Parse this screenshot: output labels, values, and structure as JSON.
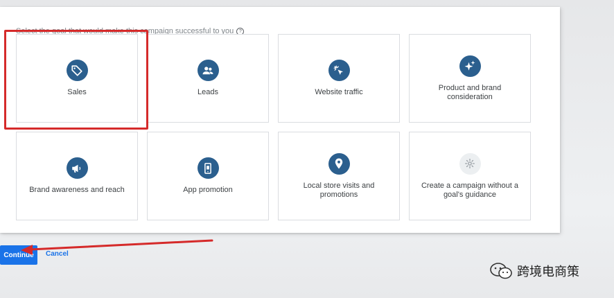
{
  "prompt": {
    "text": "Select the goal that would make this campaign successful to you",
    "help_glyph": "?"
  },
  "goals": [
    {
      "label": "Sales",
      "icon": "tag-icon",
      "selected": true
    },
    {
      "label": "Leads",
      "icon": "people-icon"
    },
    {
      "label": "Website traffic",
      "icon": "cursor-click-icon"
    },
    {
      "label": "Product and brand consideration",
      "icon": "sparkle-icon"
    },
    {
      "label": "Brand awareness and reach",
      "icon": "megaphone-icon"
    },
    {
      "label": "App promotion",
      "icon": "phone-icon"
    },
    {
      "label": "Local store visits and promotions",
      "icon": "location-pin-icon"
    },
    {
      "label": "Create a campaign without a goal's guidance",
      "icon": "gear-icon"
    }
  ],
  "actions": {
    "continue_label": "Continue",
    "cancel_label": "Cancel"
  },
  "watermark": {
    "text": "跨境电商策"
  },
  "colors": {
    "icon_bg": "#2b5f8e",
    "highlight": "#d52a2a",
    "primary": "#1a73e8"
  }
}
